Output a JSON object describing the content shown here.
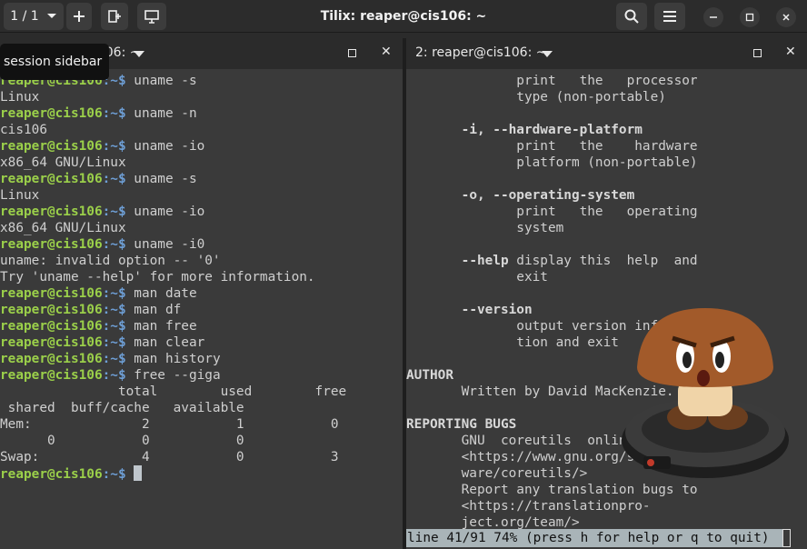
{
  "header": {
    "session_counter": "1 / 1",
    "title": "Tilix: reaper@cis106: ~",
    "tooltip": "session sidebar"
  },
  "left_terminal": {
    "title": "1: reaper@cis106: ~",
    "user_host": "reaper@cis106",
    "path": ":~$",
    "lines": [
      {
        "cmd": "uname -s"
      },
      {
        "out": "Linux"
      },
      {
        "cmd": "uname -n"
      },
      {
        "out": "cis106"
      },
      {
        "cmd": "uname -io"
      },
      {
        "out": "x86_64 GNU/Linux"
      },
      {
        "cmd": "uname -s"
      },
      {
        "out": "Linux"
      },
      {
        "cmd": "uname -io"
      },
      {
        "out": "x86_64 GNU/Linux"
      },
      {
        "cmd": "uname -i0"
      },
      {
        "out": "uname: invalid option -- '0'"
      },
      {
        "out": "Try 'uname --help' for more information."
      },
      {
        "cmd": "man date"
      },
      {
        "cmd": "man df"
      },
      {
        "cmd": "man free"
      },
      {
        "cmd": "man clear"
      },
      {
        "cmd": "man history"
      },
      {
        "cmd": "free --giga"
      },
      {
        "out": "               total        used        free"
      },
      {
        "out": " shared  buff/cache   available"
      },
      {
        "out": "Mem:              2           1           0"
      },
      {
        "out": "      0           0           0"
      },
      {
        "out": "Swap:             4           0           3"
      },
      {
        "prompt_only": true
      }
    ]
  },
  "right_terminal": {
    "title": "2: reaper@cis106: ~",
    "lines": [
      {
        "t": "              print   the   processor"
      },
      {
        "t": "              type (non-portable)"
      },
      {
        "t": ""
      },
      {
        "t": "       ",
        "bold": "-i, --hardware-platform"
      },
      {
        "t": "              print   the    hardware"
      },
      {
        "t": "              platform (non-portable)"
      },
      {
        "t": ""
      },
      {
        "t": "       ",
        "bold": "-o, --operating-system"
      },
      {
        "t": "              print   the   operating"
      },
      {
        "t": "              system"
      },
      {
        "t": ""
      },
      {
        "t": "       ",
        "bold": "--help",
        "rest": " display this  help  and"
      },
      {
        "t": "              exit"
      },
      {
        "t": ""
      },
      {
        "t": "       ",
        "bold": "--version"
      },
      {
        "t": "              output version informa-"
      },
      {
        "t": "              tion and exit"
      },
      {
        "t": ""
      },
      {
        "t": "",
        "bold": "AUTHOR"
      },
      {
        "t": "       Written by David MacKenzie."
      },
      {
        "t": ""
      },
      {
        "t": "",
        "bold": "REPORTING BUGS"
      },
      {
        "t": "       GNU  coreutils  online  help:"
      },
      {
        "t": "       <https://www.gnu.org/soft-"
      },
      {
        "t": "       ware/coreutils/>"
      },
      {
        "t": "       Report any translation bugs to"
      },
      {
        "t": "       <https://translationpro-"
      },
      {
        "t": "       ject.org/team/>"
      }
    ],
    "status": "line 41/91 74% (press h for help or q to quit)"
  }
}
